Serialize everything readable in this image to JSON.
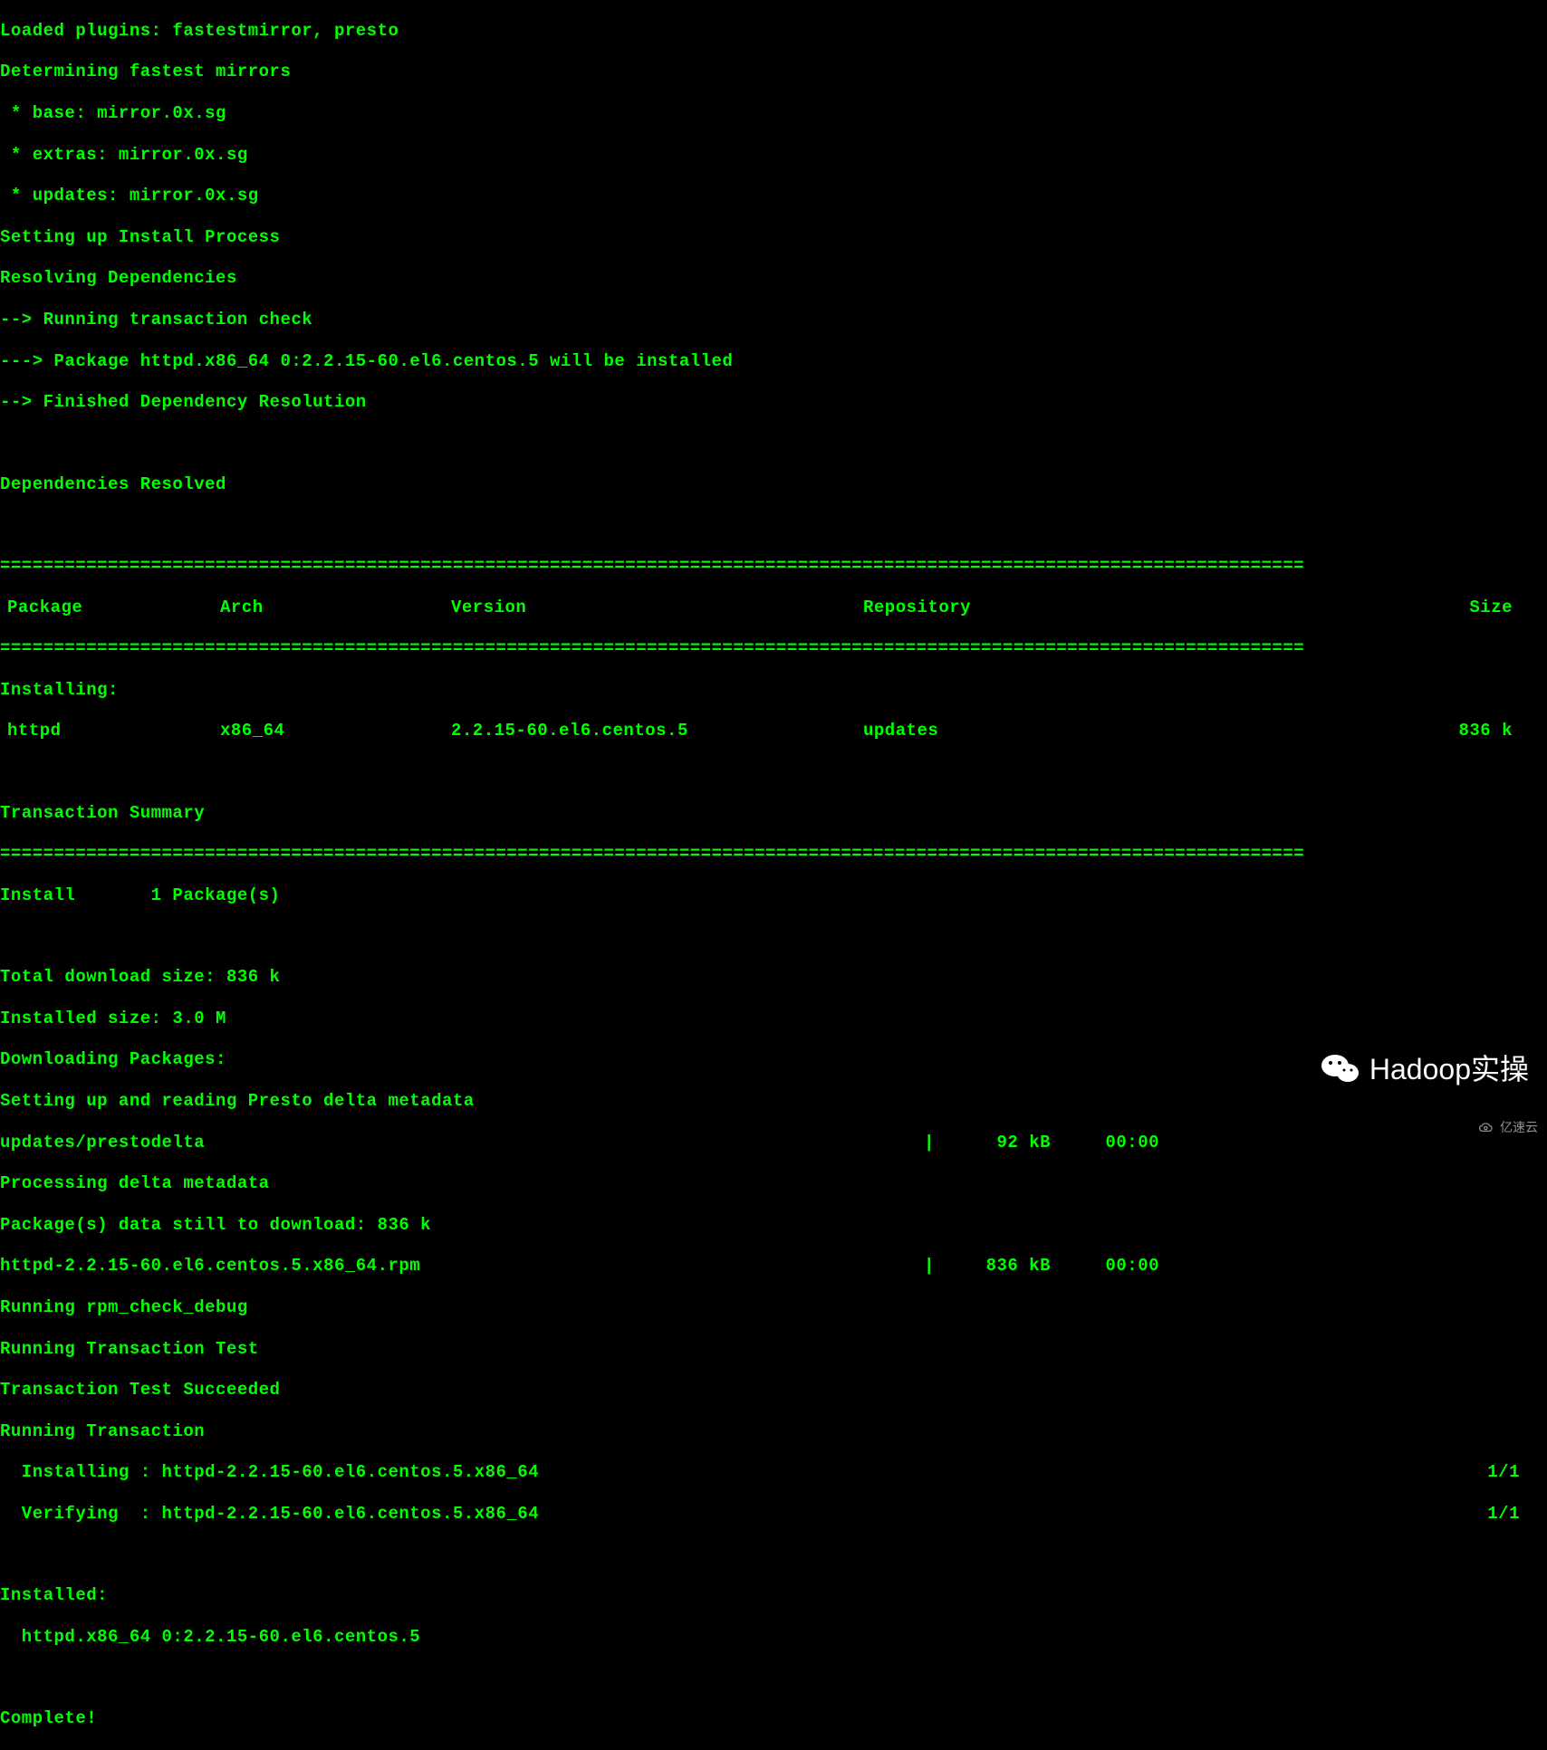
{
  "lines": {
    "loaded_plugins": "Loaded plugins: fastestmirror, presto",
    "determining": "Determining fastest mirrors",
    "base": " * base: mirror.0x.sg",
    "extras": " * extras: mirror.0x.sg",
    "updates": " * updates: mirror.0x.sg",
    "setting_up": "Setting up Install Process",
    "resolving": "Resolving Dependencies",
    "running_check": "--> Running transaction check",
    "package_install": "---> Package httpd.x86_64 0:2.2.15-60.el6.centos.5 will be installed",
    "finished": "--> Finished Dependency Resolution",
    "deps_resolved": "Dependencies Resolved",
    "installing_header": "Installing:",
    "transaction_summary": "Transaction Summary",
    "install_count": "Install       1 Package(s)",
    "total_download": "Total download size: 836 k",
    "installed_size": "Installed size: 3.0 M",
    "downloading": "Downloading Packages:",
    "presto_metadata": "Setting up and reading Presto delta metadata",
    "processing_delta": "Processing delta metadata",
    "still_download": "Package(s) data still to download: 836 k",
    "rpm_check": "Running rpm_check_debug",
    "transaction_test": "Running Transaction Test",
    "test_succeeded": "Transaction Test Succeeded",
    "running_transaction": "Running Transaction",
    "installed_header": "Installed:",
    "installed_pkg": "  httpd.x86_64 0:2.2.15-60.el6.centos.5",
    "complete": "Complete!"
  },
  "table_headers": {
    "package": "Package",
    "arch": "Arch",
    "version": "Version",
    "repository": "Repository",
    "size": "Size"
  },
  "table_row": {
    "package": "httpd",
    "arch": "x86_64",
    "version": "2.2.15-60.el6.centos.5",
    "repository": "updates",
    "size": "836 k"
  },
  "downloads": {
    "prestodelta": {
      "label": "updates/prestodelta",
      "sep": "|",
      "size": "92 kB",
      "time": "00:00"
    },
    "rpm": {
      "label": "httpd-2.2.15-60.el6.centos.5.x86_64.rpm",
      "sep": "|",
      "size": "836 kB",
      "time": "00:00"
    }
  },
  "progress": {
    "installing": {
      "label": "  Installing : httpd-2.2.15-60.el6.centos.5.x86_64",
      "count": "1/1"
    },
    "verifying": {
      "label": "  Verifying  : httpd-2.2.15-60.el6.centos.5.x86_64",
      "count": "1/1"
    }
  },
  "divider": "=========================================================================================================================",
  "watermark": {
    "main": "Hadoop实操",
    "secondary": "亿速云"
  }
}
